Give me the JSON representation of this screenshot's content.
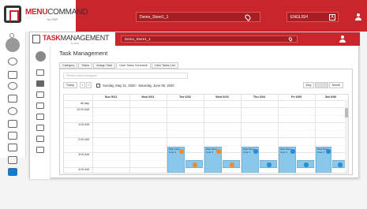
{
  "app": {
    "brand_red": "MENU",
    "brand_dark": "COMMAND",
    "brand_sub": "by PAR",
    "store": "Demo_Store1_1",
    "language": "ENGLISH",
    "lang_icon": "A"
  },
  "tm": {
    "brand_red": "TASK",
    "brand_dark": "MANAGEMENT",
    "brand_sub": "by PAR",
    "store": "Demo_Store1_1"
  },
  "page": {
    "title": "Task Management"
  },
  "tabs": [
    {
      "label": "Category"
    },
    {
      "label": "Tasks"
    },
    {
      "label": "Assign Task"
    },
    {
      "label": "User Tasks Schedule"
    },
    {
      "label": "User Tasks List"
    }
  ],
  "filter": {
    "placeholder": "Please select Assignee"
  },
  "toolbar": {
    "today": "Today",
    "prev": "‹",
    "next": "›",
    "date_range": "Sunday, May 31, 2020 - Saturday, June 06, 2020",
    "day": "Day",
    "week": "Week",
    "month": "Month"
  },
  "calendar": {
    "days": [
      "Sun 5/31",
      "Mon 6/01",
      "Tue 6/02",
      "Wed 6/03",
      "Thu 6/04",
      "Fri 6/05",
      "Sat 6/06"
    ],
    "rows": [
      "all day",
      "12:00 AM",
      "1:00 AM",
      "2:00 AM",
      "3:00 AM",
      "4:00 AM"
    ],
    "event_title": "Mop Floor",
    "event_user": "User 2"
  },
  "colors": {
    "brand": "#c9252c",
    "event": "#89c8ea",
    "badge_orange": "#f08a2b",
    "badge_blue": "#2f8bd1"
  }
}
